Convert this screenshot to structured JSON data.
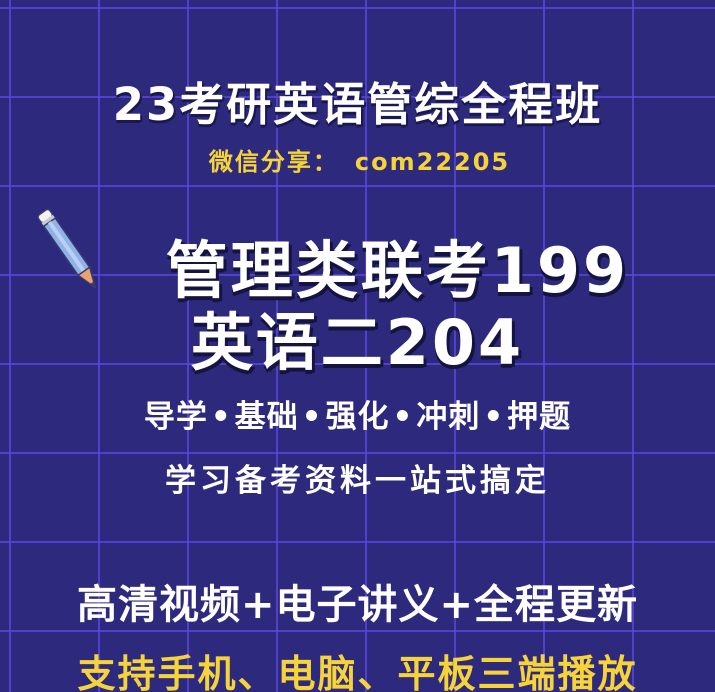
{
  "poster": {
    "title": "23考研英语管综全程班",
    "share": {
      "label": "微信分享：",
      "id": "com22205"
    },
    "score_line_1": "管理类联考199",
    "score_line_2": "英语二204",
    "stages": [
      "导学",
      "基础",
      "强化",
      "冲刺",
      "押题"
    ],
    "stage_separator": "•",
    "one_stop": "学习备考资料一站式搞定",
    "features": "高清视频+电子讲义+全程更新",
    "devices": "支持手机、电脑、平板三端播放"
  },
  "colors": {
    "background": "#2d2a7e",
    "grid": "#5c46e6",
    "text": "#ffffff",
    "accent": "#f5d339",
    "pencil_body": "#8fb3e8",
    "pencil_tip": "#e9a36b"
  },
  "icons": {
    "pencil": "pencil-icon"
  }
}
